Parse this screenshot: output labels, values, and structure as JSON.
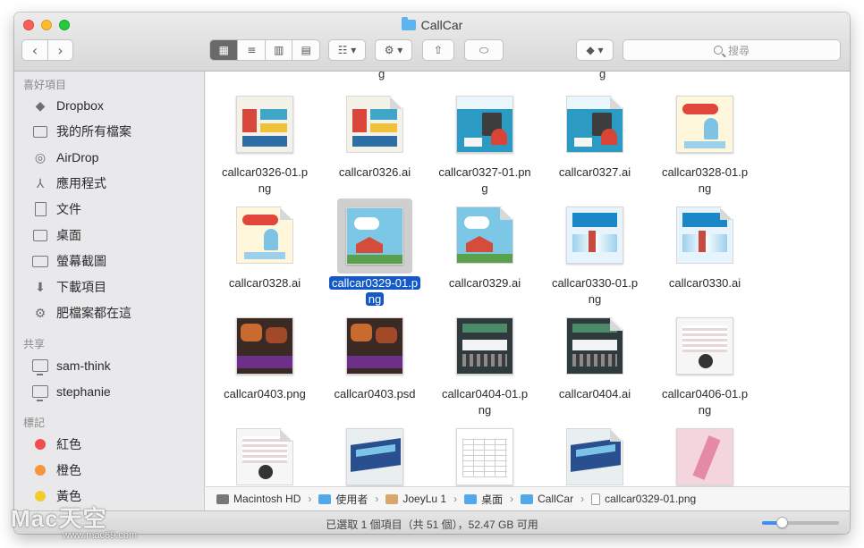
{
  "window": {
    "title": "CallCar"
  },
  "toolbar": {
    "back_glyph": "‹",
    "forward_glyph": "›",
    "view_icon_glyph": "▦",
    "view_list_glyph": "≡",
    "view_column_glyph": "▥",
    "view_cover_glyph": "▤",
    "arrange_glyph": "☷ ▾",
    "action_glyph": "⚙ ▾",
    "share_glyph": "⇧",
    "tag_glyph": "⬭",
    "dropbox_glyph": "◆ ▾",
    "search_placeholder": "搜尋"
  },
  "sidebar": {
    "favorites_header": "喜好項目",
    "favorites": [
      {
        "label": "Dropbox",
        "icon": "dropbox-icon"
      },
      {
        "label": "我的所有檔案",
        "icon": "all-files-icon"
      },
      {
        "label": "AirDrop",
        "icon": "airdrop-icon"
      },
      {
        "label": "應用程式",
        "icon": "applications-icon"
      },
      {
        "label": "文件",
        "icon": "documents-icon"
      },
      {
        "label": "桌面",
        "icon": "desktop-icon"
      },
      {
        "label": "螢幕截圖",
        "icon": "folder-icon"
      },
      {
        "label": "下載項目",
        "icon": "downloads-icon"
      },
      {
        "label": "肥檔案都在這",
        "icon": "gear-icon"
      }
    ],
    "shared_header": "共享",
    "shared": [
      {
        "label": "sam-think",
        "icon": "monitor-icon"
      },
      {
        "label": "stephanie",
        "icon": "monitor-icon"
      }
    ],
    "tags_header": "標記",
    "tags": [
      {
        "label": "紅色",
        "color": "#f14d4b"
      },
      {
        "label": "橙色",
        "color": "#f6953a"
      },
      {
        "label": "黃色",
        "color": "#f4cb2f"
      }
    ]
  },
  "files": {
    "stub_top": [
      "g",
      "g"
    ],
    "rows": [
      [
        {
          "name": "callcar0326-01.png",
          "line1": "callcar0326-01.p",
          "line2": "ng",
          "art": "poster-a",
          "ai": false
        },
        {
          "name": "callcar0326.ai",
          "line1": "callcar0326.ai",
          "line2": "",
          "art": "poster-a",
          "ai": true
        },
        {
          "name": "callcar0327-01.png",
          "line1": "callcar0327-01.pn",
          "line2": "g",
          "art": "poster-b",
          "ai": false
        },
        {
          "name": "callcar0327.ai",
          "line1": "callcar0327.ai",
          "line2": "",
          "art": "poster-b",
          "ai": true
        },
        {
          "name": "callcar0328-01.png",
          "line1": "callcar0328-01.p",
          "line2": "ng",
          "art": "poster-c",
          "ai": false
        }
      ],
      [
        {
          "name": "callcar0328.ai",
          "line1": "callcar0328.ai",
          "line2": "",
          "art": "poster-c",
          "ai": true
        },
        {
          "name": "callcar0329-01.png",
          "line1": "callcar0329-01.p",
          "line2": "ng",
          "art": "poster-d",
          "ai": false,
          "selected": true
        },
        {
          "name": "callcar0329.ai",
          "line1": "callcar0329.ai",
          "line2": "",
          "art": "poster-d",
          "ai": true
        },
        {
          "name": "callcar0330-01.png",
          "line1": "callcar0330-01.p",
          "line2": "ng",
          "art": "poster-e",
          "ai": false
        },
        {
          "name": "callcar0330.ai",
          "line1": "callcar0330.ai",
          "line2": "",
          "art": "poster-e",
          "ai": true
        }
      ],
      [
        {
          "name": "callcar0403.png",
          "line1": "callcar0403.png",
          "line2": "",
          "art": "poster-f",
          "ai": false
        },
        {
          "name": "callcar0403.psd",
          "line1": "callcar0403.psd",
          "line2": "",
          "art": "poster-f",
          "ai": false
        },
        {
          "name": "callcar0404-01.png",
          "line1": "callcar0404-01.p",
          "line2": "ng",
          "art": "poster-g",
          "ai": false
        },
        {
          "name": "callcar0404.ai",
          "line1": "callcar0404.ai",
          "line2": "",
          "art": "poster-g",
          "ai": true
        },
        {
          "name": "callcar0406-01.png",
          "line1": "callcar0406-01.p",
          "line2": "ng",
          "art": "poster-h",
          "ai": false
        }
      ],
      [
        {
          "name": "",
          "line1": "",
          "line2": "",
          "art": "poster-h",
          "ai": true
        },
        {
          "name": "",
          "line1": "",
          "line2": "",
          "art": "poster-i",
          "ai": false
        },
        {
          "name": "",
          "line1": "",
          "line2": "",
          "art": "poster-j",
          "ai": false
        },
        {
          "name": "",
          "line1": "",
          "line2": "",
          "art": "poster-i",
          "ai": true
        },
        {
          "name": "",
          "line1": "",
          "line2": "",
          "art": "poster-k",
          "ai": false
        }
      ]
    ]
  },
  "pathbar": {
    "crumbs": [
      {
        "label": "Macintosh HD",
        "icon": "ci-hd"
      },
      {
        "label": "使用者",
        "icon": "ci-folder"
      },
      {
        "label": "JoeyLu 1",
        "icon": "ci-home"
      },
      {
        "label": "桌面",
        "icon": "ci-folder"
      },
      {
        "label": "CallCar",
        "icon": "ci-folder"
      },
      {
        "label": "callcar0329-01.png",
        "icon": "ci-file"
      }
    ],
    "separator": "›"
  },
  "status": {
    "text": "已選取 1 個項目（共 51 個），52.47 GB 可用",
    "zoom_level": 0.25
  },
  "watermark": {
    "big": "Mac天空",
    "small": "www.mac69.com"
  },
  "colors": {
    "selection": "#1459c8",
    "accent": "#3d8ef7"
  }
}
